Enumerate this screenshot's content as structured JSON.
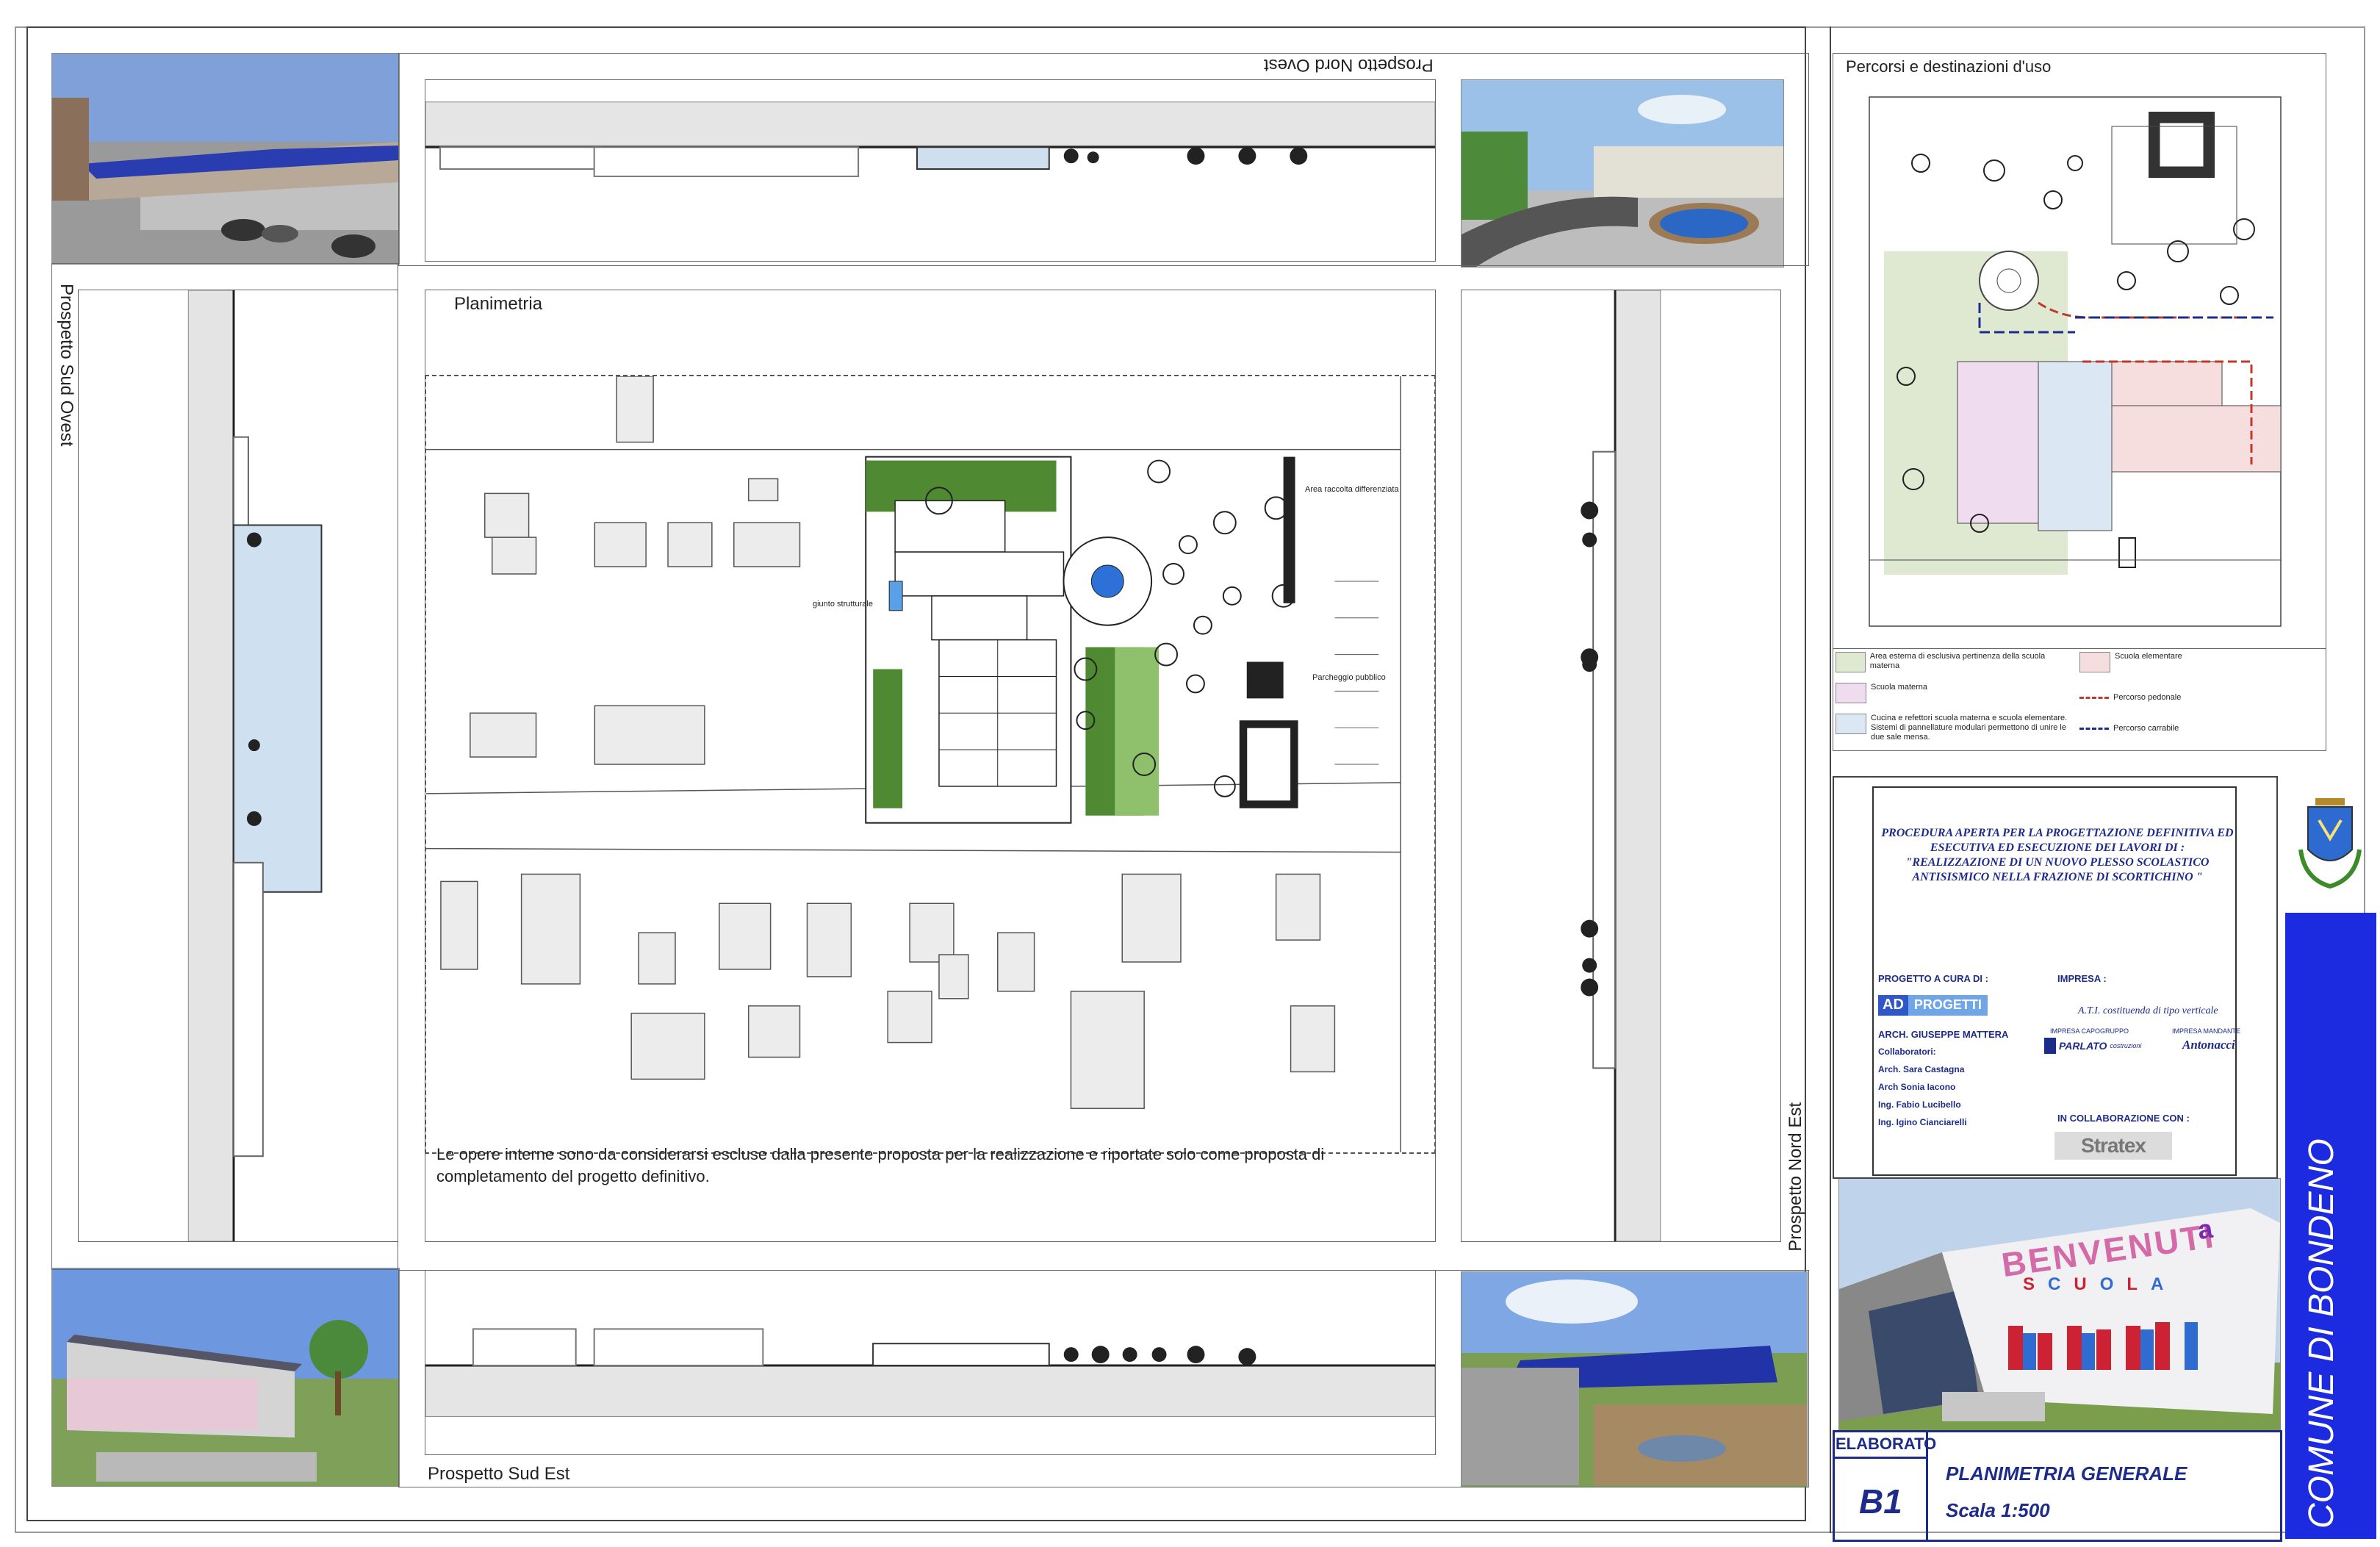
{
  "sheet": {
    "views": {
      "top_elevation": "Prospetto Nord Ovest",
      "bottom_elevation": "Prospetto Sud Est",
      "left_elevation": "Prospetto Sud Ovest",
      "right_elevation": "Prospetto Nord Est",
      "plan_title": "Planimetria",
      "routes_title": "Percorsi e destinazioni d'uso"
    },
    "plan_labels": {
      "waste_area": "Area raccolta differenziata",
      "parking": "Parcheggio pubblico",
      "joint": "giunto strutturale"
    },
    "note": "Le opere interne sono da considerarsi escluse dalla presente proposta per la realizzazione e riportate solo come proposta di completamento del progetto definitivo.",
    "legend": [
      {
        "text": "Area esterna di esclusiva pertinenza della scuola materna",
        "color": "#dfe9d2"
      },
      {
        "text": "Scuola elementare",
        "color": "#f6dede"
      },
      {
        "text": "Scuola materna",
        "color": "#f0dcef"
      },
      {
        "text": "Percorso pedonale",
        "color": "#c0392b"
      },
      {
        "text": "Cucina e refettori scuola materna e scuola elementare. Sistemi di pannellature modulari permettono di unire le due sale mensa.",
        "color": "#dbe7f3"
      },
      {
        "text": "Percorso carrabile",
        "color": "#1d2c8a"
      }
    ],
    "title_block": {
      "procedure": "PROCEDURA APERTA PER LA PROGETTAZIONE DEFINITIVA ED ESECUTIVA ED ESECUZIONE DEI LAVORI DI :",
      "project_quote": "\"REALIZZAZIONE DI UN NUOVO PLESSO SCOLASTICO ANTISISMICO NELLA FRAZIONE DI SCORTICHINO \"",
      "design_label": "PROGETTO A CURA DI :",
      "company_label": "IMPRESA :",
      "ati": "A.T.I. costituenda di tipo verticale",
      "logo_ad": "AD",
      "logo_progetti": "PROGETTI",
      "architect": "ARCH. GIUSEPPE MATTERA",
      "collab_label": "Collaboratori:",
      "collaborators": [
        "Arch. Sara Castagna",
        "Arch Sonia Iacono",
        "Ing. Fabio Lucibello",
        "Ing. Igino  Cianciarelli"
      ],
      "lead_company_label": "IMPRESA CAPOGRUPPO",
      "lead_company": "PARLATO",
      "lead_company_sub": "costruzioni",
      "principal_label": "IMPRESA MANDANTE",
      "principal_company": "Antonacci",
      "collab_with": "IN COLLABORAZIONE  CON :",
      "stratex": "Stratex",
      "welcome": "BENVENUTI",
      "welcome_suffix": "a",
      "scuola_letters": [
        "S",
        "C",
        "U",
        "O",
        "L",
        "A"
      ],
      "elaborato_label": "ELABORATO",
      "elaborato": "B1",
      "drawing_title": "PLANIMETRIA GENERALE",
      "scale": "Scala 1:500",
      "municipality": "COMUNE DI BONDENO"
    }
  }
}
